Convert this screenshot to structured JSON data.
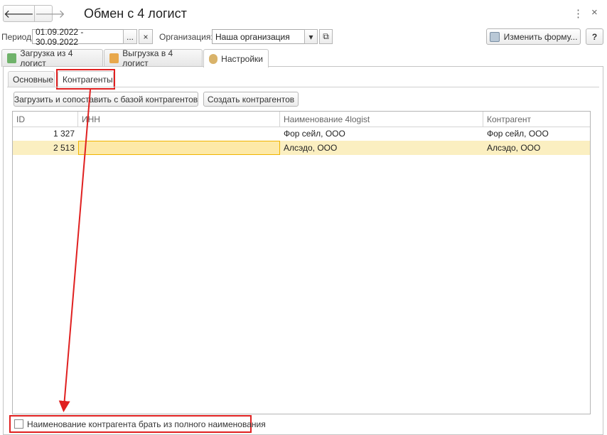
{
  "window": {
    "title": "Обмен с 4 логист",
    "more_glyph": "⋮",
    "close_glyph": "×",
    "back_glyph": "🡐",
    "forward_glyph": "🡒"
  },
  "filters": {
    "period_label": "Период:",
    "period_value": "01.09.2022 - 30.09.2022",
    "period_picker": "...",
    "period_clear": "×",
    "org_label": "Организация:",
    "org_value": "Наша организация",
    "org_dropdown": "▾",
    "org_open": "⧉"
  },
  "toolbar": {
    "change_form_label": "Изменить форму...",
    "help_label": "?"
  },
  "tabs": [
    {
      "label": "Загрузка из 4 логист",
      "icon": "import-icon"
    },
    {
      "label": "Выгрузка в 4 логист",
      "icon": "export-icon"
    },
    {
      "label": "Настройки",
      "icon": "settings-icon"
    }
  ],
  "subtabs": [
    {
      "label": "Основные"
    },
    {
      "label": "Контрагенты"
    }
  ],
  "actions": {
    "load_match": "Загрузить и сопоставить с базой контрагентов",
    "create": "Создать контрагентов"
  },
  "table": {
    "columns": [
      "ID",
      "ИНН",
      "Наименование 4logist",
      "Контрагент"
    ],
    "rows": [
      {
        "id": "1 327",
        "inn": "",
        "name": "Фор сейл, ООО",
        "counterparty": "Фор сейл, ООО"
      },
      {
        "id": "2 513",
        "inn": "",
        "name": "Алсэдо, ООО",
        "counterparty": "Алсэдо, ООО"
      }
    ]
  },
  "option": {
    "checkbox_label": "Наименование контрагента брать из полного наименования",
    "checked": false
  },
  "colors": {
    "annotation": "#e02020",
    "selected_row": "#fbefc1",
    "active_cell_border": "#f0b400"
  }
}
